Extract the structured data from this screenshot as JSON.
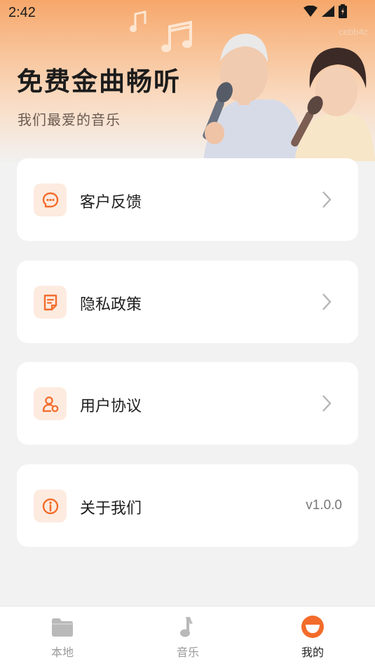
{
  "status_bar": {
    "time": "2:42"
  },
  "watermark": "cebb4c",
  "hero": {
    "title": "免费金曲畅听",
    "subtitle": "我们最爱的音乐"
  },
  "menu": [
    {
      "label": "客户反馈",
      "icon": "chat-bubble-icon"
    },
    {
      "label": "隐私政策",
      "icon": "document-icon"
    },
    {
      "label": "用户协议",
      "icon": "user-settings-icon"
    },
    {
      "label": "关于我们",
      "icon": "info-icon",
      "value": "v1.0.0"
    }
  ],
  "tabs": [
    {
      "label": "本地",
      "icon": "folder-icon"
    },
    {
      "label": "音乐",
      "icon": "music-note-icon"
    },
    {
      "label": "我的",
      "icon": "profile-icon",
      "active": true
    }
  ],
  "colors": {
    "accent": "#f36c2b",
    "icon_bg": "#fdebe0",
    "page_bg": "#f2f2f2"
  }
}
